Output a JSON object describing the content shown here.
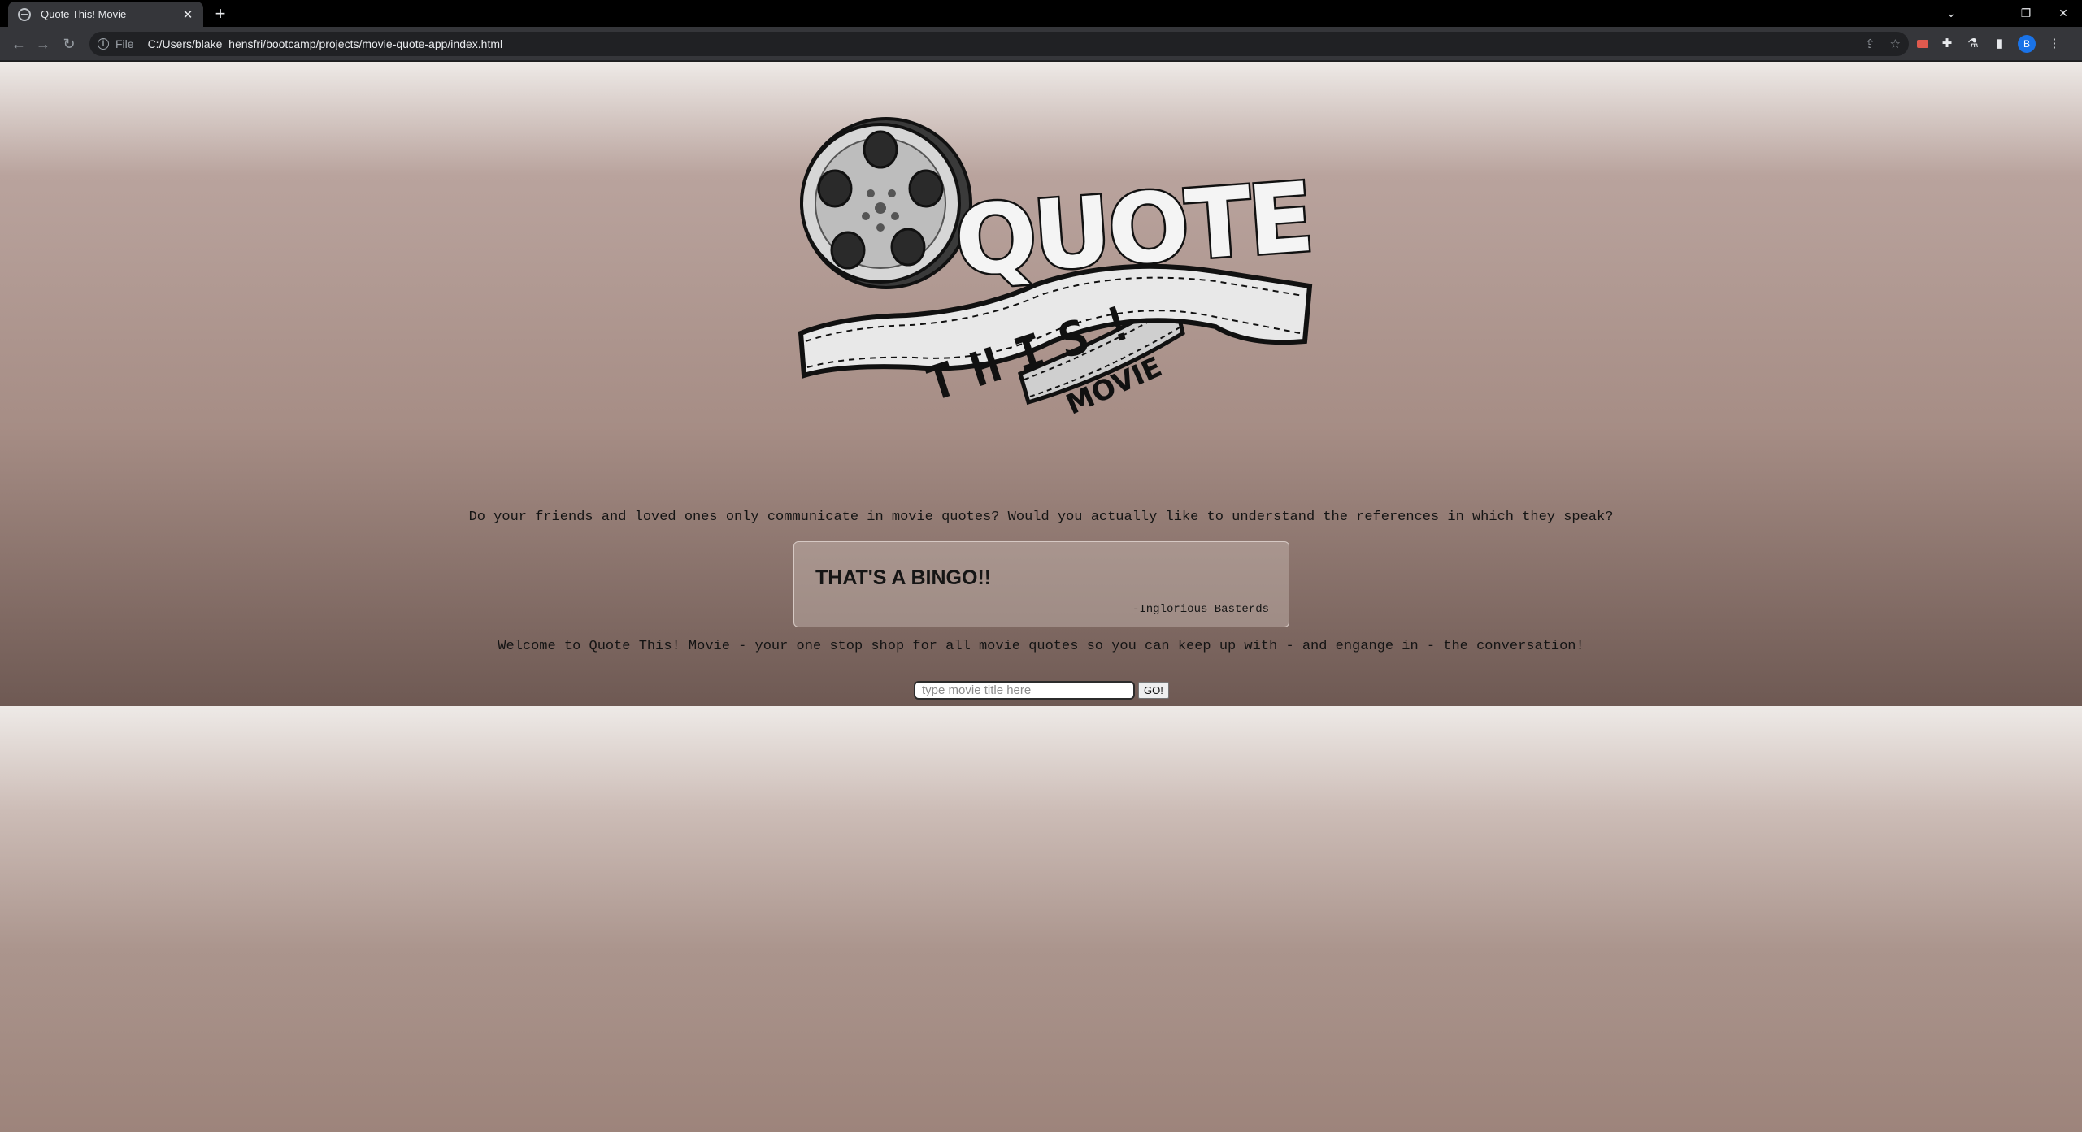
{
  "browser": {
    "tab_title": "Quote This! Movie",
    "scheme_label": "File",
    "url": "C:/Users/blake_hensfri/bootcamp/projects/movie-quote-app/index.html",
    "profile_initial": "B"
  },
  "logo": {
    "word_quote": "QUOTE",
    "word_this": "THIS!",
    "word_movie": "MOVIE"
  },
  "page": {
    "intro": "Do your friends and loved ones only communicate in movie quotes? Would you actually like to understand the references in which they speak?",
    "quote": {
      "text": "THAT'S A BINGO!!",
      "source": "-Inglorious Basterds"
    },
    "welcome": "Welcome to Quote This! Movie - your one stop shop for all movie quotes so you can keep up with - and engange in - the conversation!",
    "search": {
      "placeholder": "type movie title here",
      "button_label": "GO!"
    }
  },
  "icons": {
    "favicon": "globe-icon",
    "back": "back-arrow-icon",
    "forward": "forward-arrow-icon",
    "reload": "reload-icon",
    "info": "info-icon",
    "share": "share-icon",
    "bookmark": "star-icon",
    "extensions": "puzzle-icon",
    "side_panel": "side-panel-icon",
    "menu": "kebab-menu-icon"
  }
}
